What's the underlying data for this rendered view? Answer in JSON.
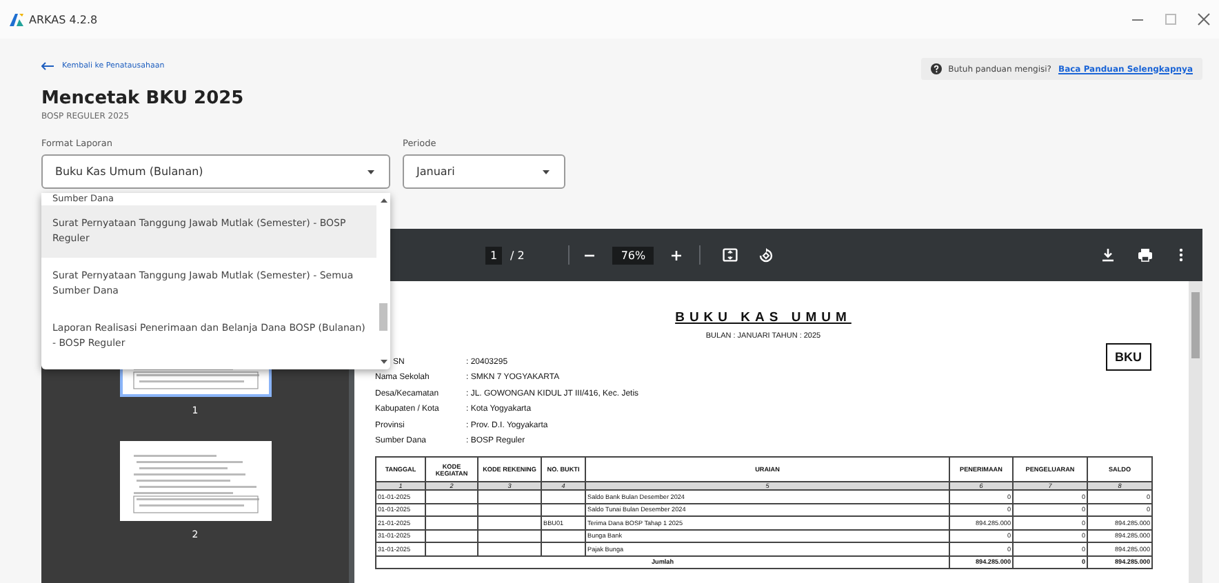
{
  "window": {
    "title": "ARKAS 4.2.8"
  },
  "back_link": "Kembali ke Penatausahaan",
  "page_title": "Mencetak BKU 2025",
  "subtitle": "BOSP REGULER 2025",
  "help": {
    "text": "Butuh panduan mengisi?",
    "link": "Baca Panduan Selengkapnya"
  },
  "fields": [
    {
      "label": "Format Laporan",
      "value": "Buku Kas Umum (Bulanan)"
    },
    {
      "label": "Periode",
      "value": "Januari"
    }
  ],
  "dropdown": {
    "options": [
      {
        "label": "Sumber Dana",
        "highlighted": false
      },
      {
        "label": "Surat Pernyataan Tanggung Jawab Mutlak (Semester) - BOSP Reguler",
        "highlighted": true
      },
      {
        "label": "Surat Pernyataan Tanggung Jawab Mutlak (Semester) - Semua Sumber Dana",
        "highlighted": false
      },
      {
        "label": "Laporan Realisasi Penerimaan dan Belanja Dana BOSP (Bulanan) - BOSP Reguler",
        "highlighted": false
      }
    ]
  },
  "viewer": {
    "page": "1",
    "page_total": "/ 2",
    "zoom": "76%",
    "thumbnails": [
      {
        "label": "1",
        "selected": true
      },
      {
        "label": "2",
        "selected": false
      }
    ]
  },
  "document": {
    "title": "BUKU KAS UMUM",
    "period": "BULAN : JANUARI TAHUN : 2025",
    "code": "BKU",
    "info": [
      {
        "label": "SN",
        "value": ": 20403295"
      },
      {
        "label": "Nama Sekolah",
        "value": ": SMKN 7 YOGYAKARTA"
      },
      {
        "label": "Desa/Kecamatan",
        "value": ": JL. GOWONGAN KIDUL JT III/416, Kec. Jetis"
      },
      {
        "label": "Kabupaten / Kota",
        "value": ": Kota Yogyakarta"
      },
      {
        "label": "Provinsi",
        "value": ": Prov. D.I. Yogyakarta"
      },
      {
        "label": "Sumber Dana",
        "value": ": BOSP Reguler"
      }
    ],
    "table": {
      "columns": [
        "TANGGAL",
        "KODE KEGIATAN",
        "KODE REKENING",
        "NO. BUKTI",
        "URAIAN",
        "PENERIMAAN",
        "PENGELUARAN",
        "SALDO"
      ],
      "column_numbers": [
        "1",
        "2",
        "3",
        "4",
        "5",
        "6",
        "7",
        "8"
      ],
      "rows": [
        {
          "date": "01-01-2025",
          "description": "Saldo Bank Bulan Desember 2024",
          "receipts": "0",
          "expenditures": "0",
          "balance": "0"
        },
        {
          "date": "01-01-2025",
          "description": "Saldo Tunai Bulan Desember 2024",
          "receipts": "0",
          "expenditures": "0",
          "balance": "0"
        },
        {
          "date": "21-01-2025",
          "voucher": "BBU01",
          "description": "Terima Dana BOSP Tahap 1 2025",
          "receipts": "894.285.000",
          "expenditures": "0",
          "balance": "894.285.000"
        },
        {
          "date": "31-01-2025",
          "description": "Bunga Bank",
          "receipts": "0",
          "expenditures": "0",
          "balance": "894.285.000"
        },
        {
          "date": "31-01-2025",
          "description": "Pajak Bunga",
          "receipts": "0",
          "expenditures": "0",
          "balance": "894.285.000"
        }
      ],
      "total": {
        "label": "Jumlah",
        "receipts": "894.285.000",
        "expenditures": "0",
        "balance": "894.285.000"
      }
    }
  }
}
